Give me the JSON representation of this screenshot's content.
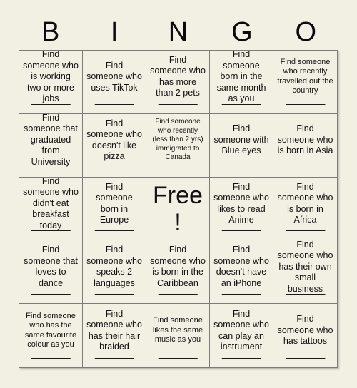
{
  "card": {
    "title": "BINGO",
    "header_letters": [
      "B",
      "I",
      "N",
      "G",
      "O"
    ],
    "background_color": "#f2efe3",
    "border_color": "#7c7c78",
    "text_color": "#111111",
    "columns": 5,
    "rows": 5
  },
  "cells": [
    {
      "text": "Find someone who is working two or more jobs",
      "size": "normal",
      "has_line": true,
      "free": false
    },
    {
      "text": "Find someone who uses TikTok",
      "size": "normal",
      "has_line": true,
      "free": false
    },
    {
      "text": "Find someone who has more than 2 pets",
      "size": "normal",
      "has_line": true,
      "free": false
    },
    {
      "text": "Find someone born in the same month as you",
      "size": "normal",
      "has_line": true,
      "free": false
    },
    {
      "text": "Find someone who recently travelled out the country",
      "size": "small",
      "has_line": true,
      "free": false
    },
    {
      "text": "Find someone that graduated from University",
      "size": "normal",
      "has_line": true,
      "free": false
    },
    {
      "text": "Find someone who doesn't like pizza",
      "size": "normal",
      "has_line": true,
      "free": false
    },
    {
      "text": "Find someone who recently (less than 2 yrs) immigrated to Canada",
      "size": "xsmall",
      "has_line": true,
      "free": false
    },
    {
      "text": "Find someone with Blue eyes",
      "size": "normal",
      "has_line": true,
      "free": false
    },
    {
      "text": "Find someone who is born in Asia",
      "size": "normal",
      "has_line": true,
      "free": false
    },
    {
      "text": "Find someone who didn't eat breakfast today",
      "size": "normal",
      "has_line": true,
      "free": false
    },
    {
      "text": "Find someone born in Europe",
      "size": "normal",
      "has_line": true,
      "free": false
    },
    {
      "text": "Free!",
      "size": "free",
      "has_line": false,
      "free": true
    },
    {
      "text": "Find someone who likes to read Anime",
      "size": "normal",
      "has_line": true,
      "free": false
    },
    {
      "text": "Find someone who is born in Africa",
      "size": "normal",
      "has_line": true,
      "free": false
    },
    {
      "text": "Find someone that loves to dance",
      "size": "normal",
      "has_line": true,
      "free": false
    },
    {
      "text": "Find someone who speaks 2 languages",
      "size": "normal",
      "has_line": true,
      "free": false
    },
    {
      "text": "Find someone who is born in the Caribbean",
      "size": "normal",
      "has_line": true,
      "free": false
    },
    {
      "text": "Find someone who doesn't have an iPhone",
      "size": "normal",
      "has_line": true,
      "free": false
    },
    {
      "text": "Find someone who has their own small business",
      "size": "normal",
      "has_line": true,
      "free": false
    },
    {
      "text": "Find someone who has the same favourite colour as you",
      "size": "small",
      "has_line": true,
      "free": false
    },
    {
      "text": "Find someone who has their hair braided",
      "size": "normal",
      "has_line": true,
      "free": false
    },
    {
      "text": "Find someone likes the same music as you",
      "size": "small",
      "has_line": true,
      "free": false
    },
    {
      "text": "Find someone who can play an instrument",
      "size": "normal",
      "has_line": true,
      "free": false
    },
    {
      "text": "Find someone who has tattoos",
      "size": "normal",
      "has_line": true,
      "free": false
    }
  ]
}
